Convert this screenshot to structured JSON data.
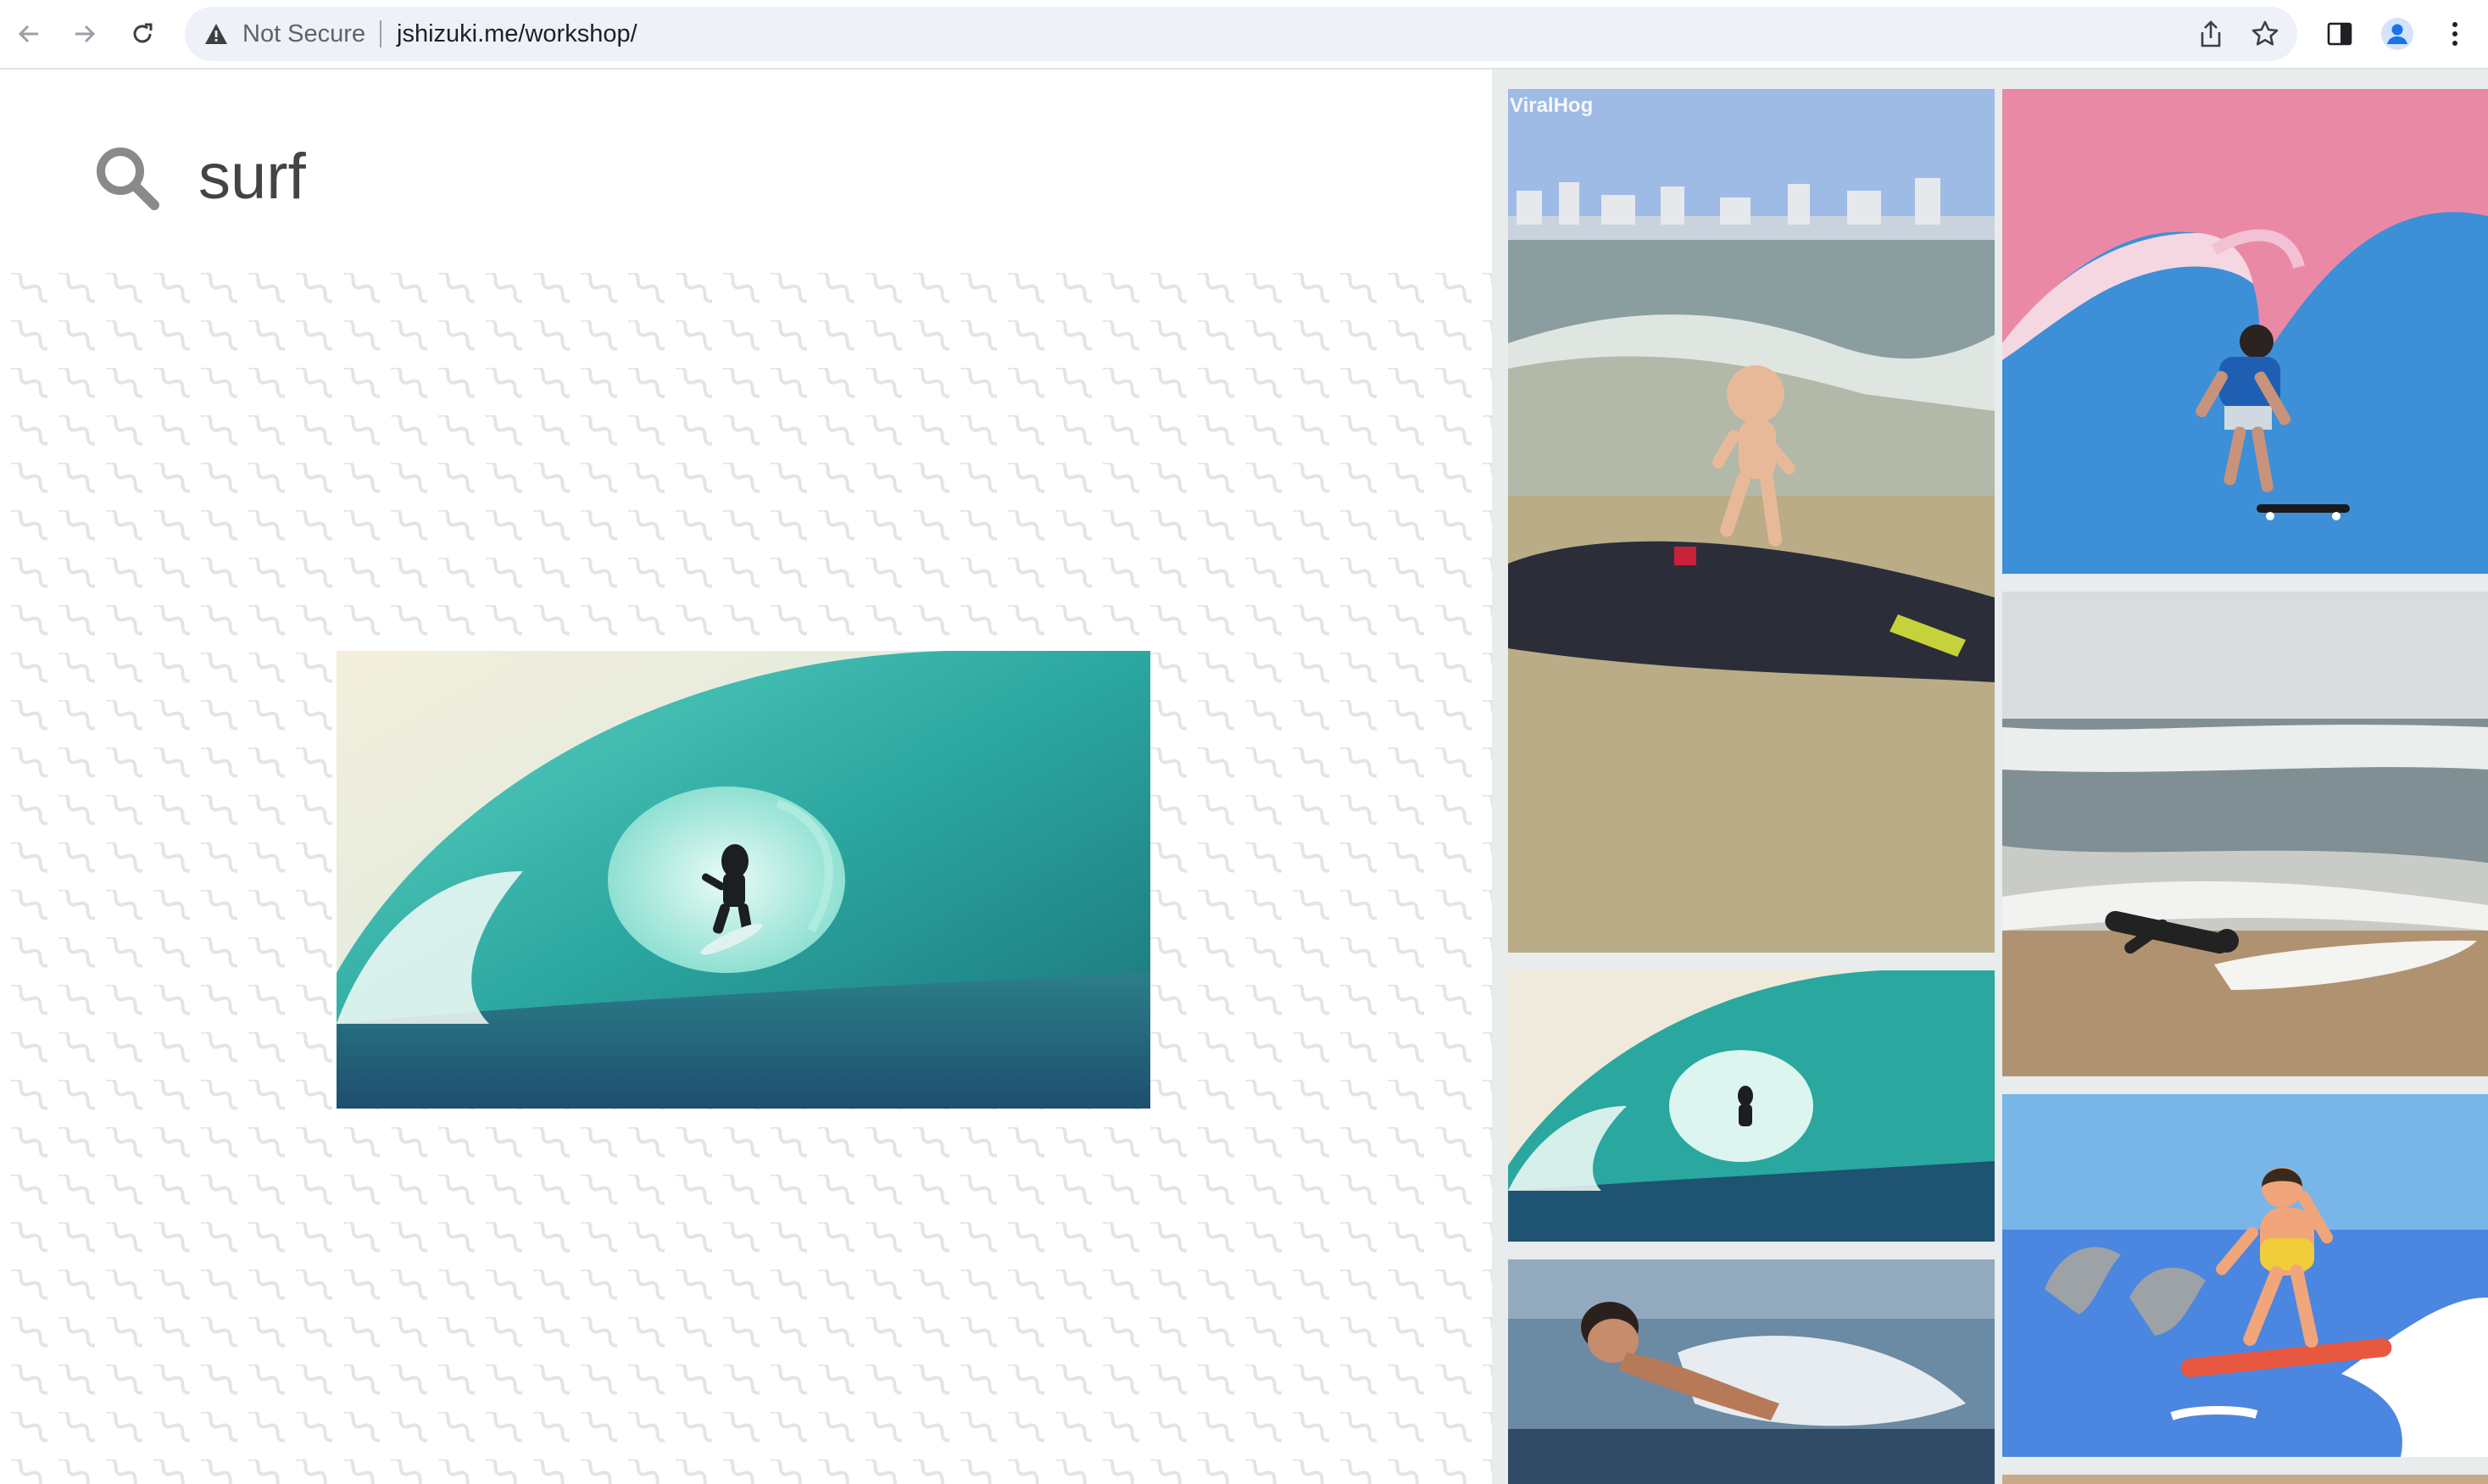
{
  "browser": {
    "security_label": "Not Secure",
    "url": "jshizuki.me/workshop/",
    "icons": {
      "back": "back-arrow-icon",
      "forward": "forward-arrow-icon",
      "reload": "reload-icon",
      "warning": "warning-icon",
      "share": "share-icon",
      "bookmark": "star-icon",
      "side_panel": "side-panel-icon",
      "profile": "profile-icon",
      "menu": "kebab-menu-icon"
    }
  },
  "search": {
    "query": "surf",
    "icon": "search-icon"
  },
  "featured": {
    "alt": "surfer-in-barrel-wave"
  },
  "gallery": {
    "watermark": "ViralHog",
    "tiles": [
      {
        "alt": "baby-surfing-on-board"
      },
      {
        "alt": "man-skateboarding-on-wave-illustration"
      },
      {
        "alt": "man-lying-on-beach-with-surfboard"
      },
      {
        "alt": "surfer-in-barrel-wave-small"
      },
      {
        "alt": "man-swimming-in-ocean"
      },
      {
        "alt": "cartoon-surfer-with-dolphins"
      }
    ]
  },
  "colors": {
    "omnibox_bg": "#eef1f7",
    "accent_profile": "#1a73e8",
    "gallery_bg": "#e8ecec"
  }
}
